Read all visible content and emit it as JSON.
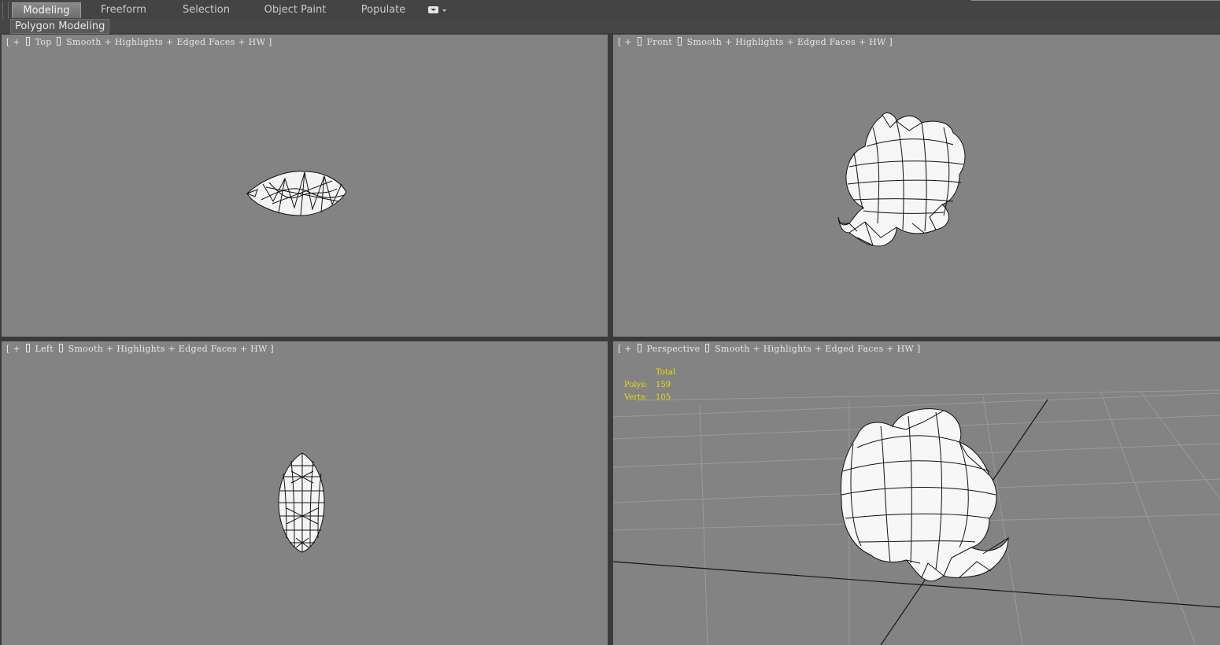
{
  "ribbon": {
    "tabs": [
      {
        "label": "Modeling",
        "active": true
      },
      {
        "label": "Freeform",
        "active": false
      },
      {
        "label": "Selection",
        "active": false
      },
      {
        "label": "Object Paint",
        "active": false
      },
      {
        "label": "Populate",
        "active": false
      }
    ],
    "dropdown_icon": "chevron-down-icon"
  },
  "subbar": {
    "panel_label": "Polygon Modeling"
  },
  "viewports": {
    "top": {
      "plus": "[ + ",
      "name": " Top ",
      "shading": " Smooth + Highlights + Edged Faces + HW ]"
    },
    "front": {
      "plus": "[ + ",
      "name": " Front ",
      "shading": " Smooth + Highlights + Edged Faces + HW ]"
    },
    "left": {
      "plus": "[ + ",
      "name": " Left ",
      "shading": " Smooth + Highlights + Edged Faces + HW ]"
    },
    "perspective": {
      "plus": "[ + ",
      "name": " Perspective ",
      "shading": " Smooth + Highlights + Edged Faces + HW ]",
      "stats": {
        "title": "Total",
        "polys_label": "Polys:",
        "polys_value": "159",
        "verts_label": "Verts:",
        "verts_value": "105"
      }
    }
  },
  "colors": {
    "viewport_bg": "#838383",
    "stats_text": "#e8e000",
    "active_tab": "#7a7a7a"
  }
}
